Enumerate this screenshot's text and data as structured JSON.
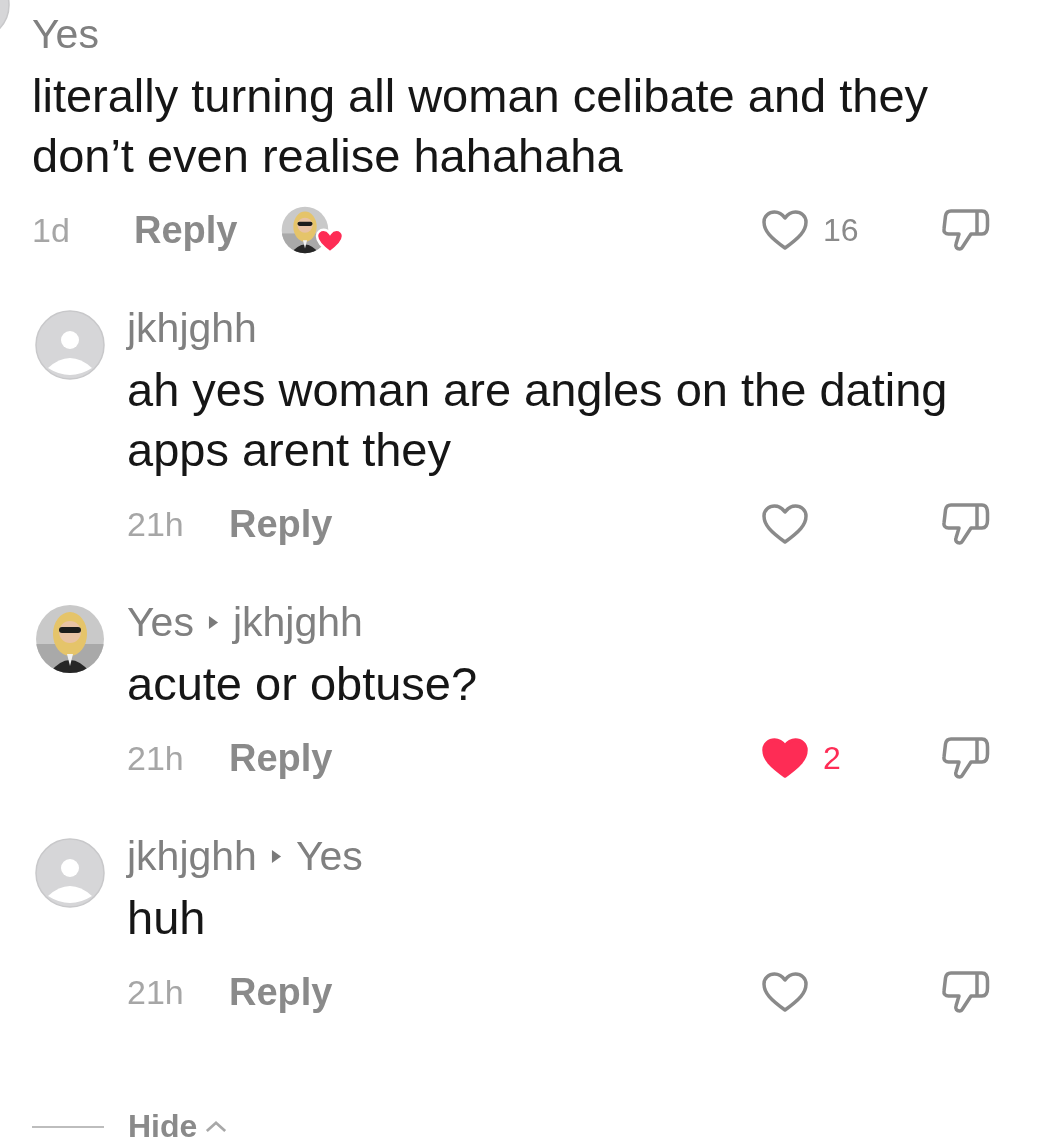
{
  "comment": {
    "username": "Yes",
    "avatar": {
      "kind": "default"
    },
    "text": "literally turning all woman celibate and they don’t even realise hahahaha",
    "time": "1d",
    "reply_label": "Reply",
    "creator_liked": true,
    "liked": false,
    "likes": "16"
  },
  "replies": [
    {
      "username": "jkhjghh",
      "avatar": {
        "kind": "default"
      },
      "text": "ah yes woman are angles on the dating apps arent they",
      "time": "21h",
      "reply_label": "Reply",
      "liked": false
    },
    {
      "username": "Yes",
      "reply_to": "jkhjghh",
      "text": "acute or obtuse?",
      "time": "21h",
      "reply_label": "Reply",
      "liked": true,
      "likes": "2"
    },
    {
      "username": "jkhjghh",
      "reply_to": "Yes",
      "avatar": {
        "kind": "default"
      },
      "text": "huh",
      "time": "21h",
      "reply_label": "Reply",
      "liked": false
    }
  ],
  "hide_label": "Hide"
}
